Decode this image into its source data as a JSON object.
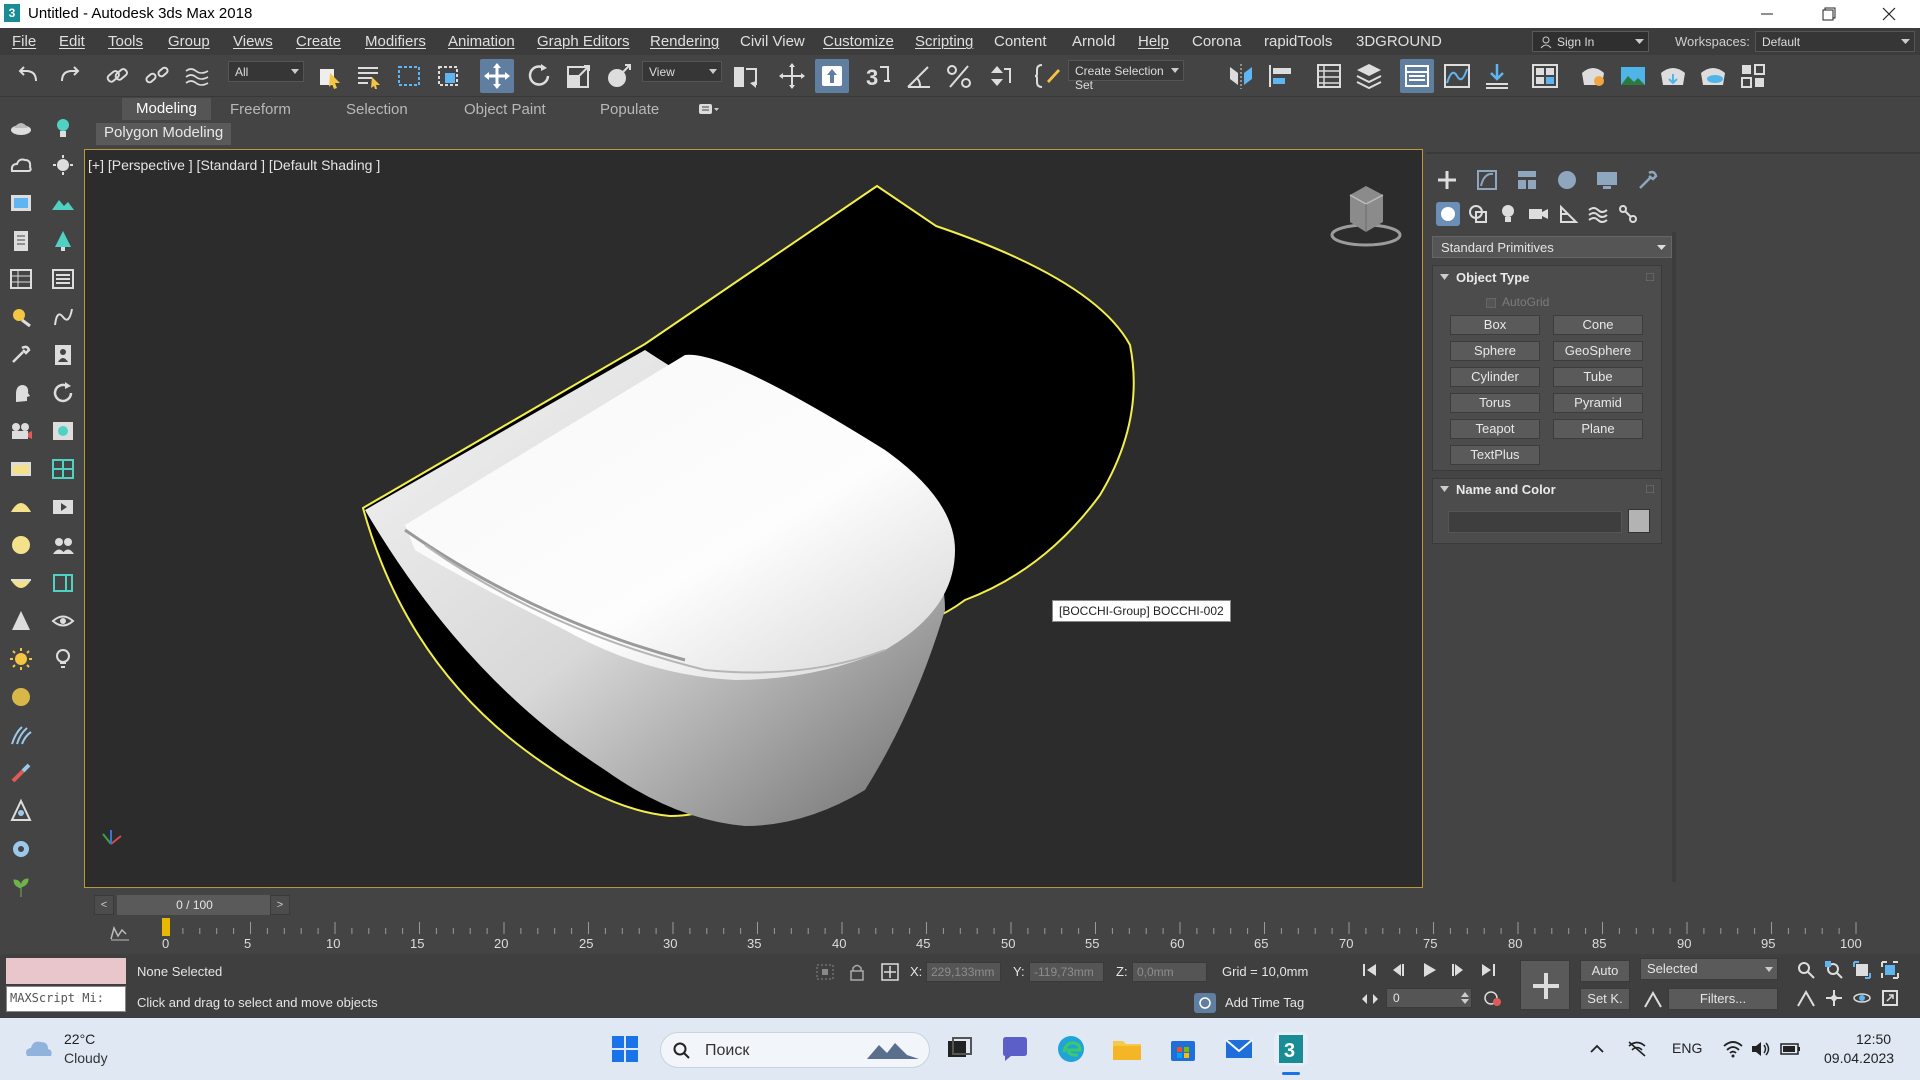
{
  "window": {
    "title": "Untitled - Autodesk 3ds Max 2018",
    "logo_char": "3"
  },
  "menu": {
    "items": [
      "File",
      "Edit",
      "Tools",
      "Group",
      "Views",
      "Create",
      "Modifiers",
      "Animation",
      "Graph Editors",
      "Rendering",
      "Civil View",
      "Customize",
      "Scripting",
      "Content",
      "Arnold",
      "Help",
      "Corona",
      "rapidTools",
      "3DGROUND"
    ],
    "sign_in": "Sign In",
    "workspaces_label": "Workspaces:",
    "workspace_value": "Default"
  },
  "toolbar": {
    "filter_value": "All",
    "refcoord_value": "View",
    "selection_set_placeholder": "Create Selection Set"
  },
  "ribbon": {
    "tabs": [
      "Modeling",
      "Freeform",
      "Selection",
      "Object Paint",
      "Populate"
    ],
    "active_tab": "Modeling",
    "subtitle": "Polygon Modeling"
  },
  "viewport": {
    "label": "[+] [Perspective ] [Standard ] [Default Shading ]",
    "tooltip": "[BOCCHI-Group] BOCCHI-002",
    "background_color": "#2c2c2c",
    "selection_outline_color": "#f2ef4a"
  },
  "command_panel": {
    "category": "Standard Primitives",
    "object_type_title": "Object Type",
    "autogrid_label": "AutoGrid",
    "buttons": [
      "Box",
      "Cone",
      "Sphere",
      "GeoSphere",
      "Cylinder",
      "Tube",
      "Torus",
      "Pyramid",
      "Teapot",
      "Plane",
      "TextPlus"
    ],
    "name_color_title": "Name and Color",
    "swatch_color": "#b3b3b3"
  },
  "timeline": {
    "slider_text": "0 / 100",
    "prev": "<",
    "next": ">",
    "ticks": [
      "0",
      "5",
      "10",
      "15",
      "20",
      "25",
      "30",
      "35",
      "40",
      "45",
      "50",
      "55",
      "60",
      "65",
      "70",
      "75",
      "80",
      "85",
      "90",
      "95",
      "100"
    ]
  },
  "status": {
    "maxscript_placeholder": "MAXScript Mi:",
    "selection_text": "None Selected",
    "prompt_text": "Click and drag to select and move objects",
    "x_label": "X:",
    "x_value": "229,133mm",
    "y_label": "Y:",
    "y_value": "-119,73mm",
    "z_label": "Z:",
    "z_value": "0,0mm",
    "grid_text": "Grid = 10,0mm",
    "add_time_tag": "Add Time Tag",
    "auto_label": "Auto",
    "setk_label": "Set K.",
    "key_filter_value": "Selected",
    "filters_label": "Filters...",
    "frame_value": "0"
  },
  "taskbar": {
    "weather_temp": "22°C",
    "weather_desc": "Cloudy",
    "search_placeholder": "Поиск",
    "language": "ENG",
    "time": "12:50",
    "date": "09.04.2023"
  }
}
